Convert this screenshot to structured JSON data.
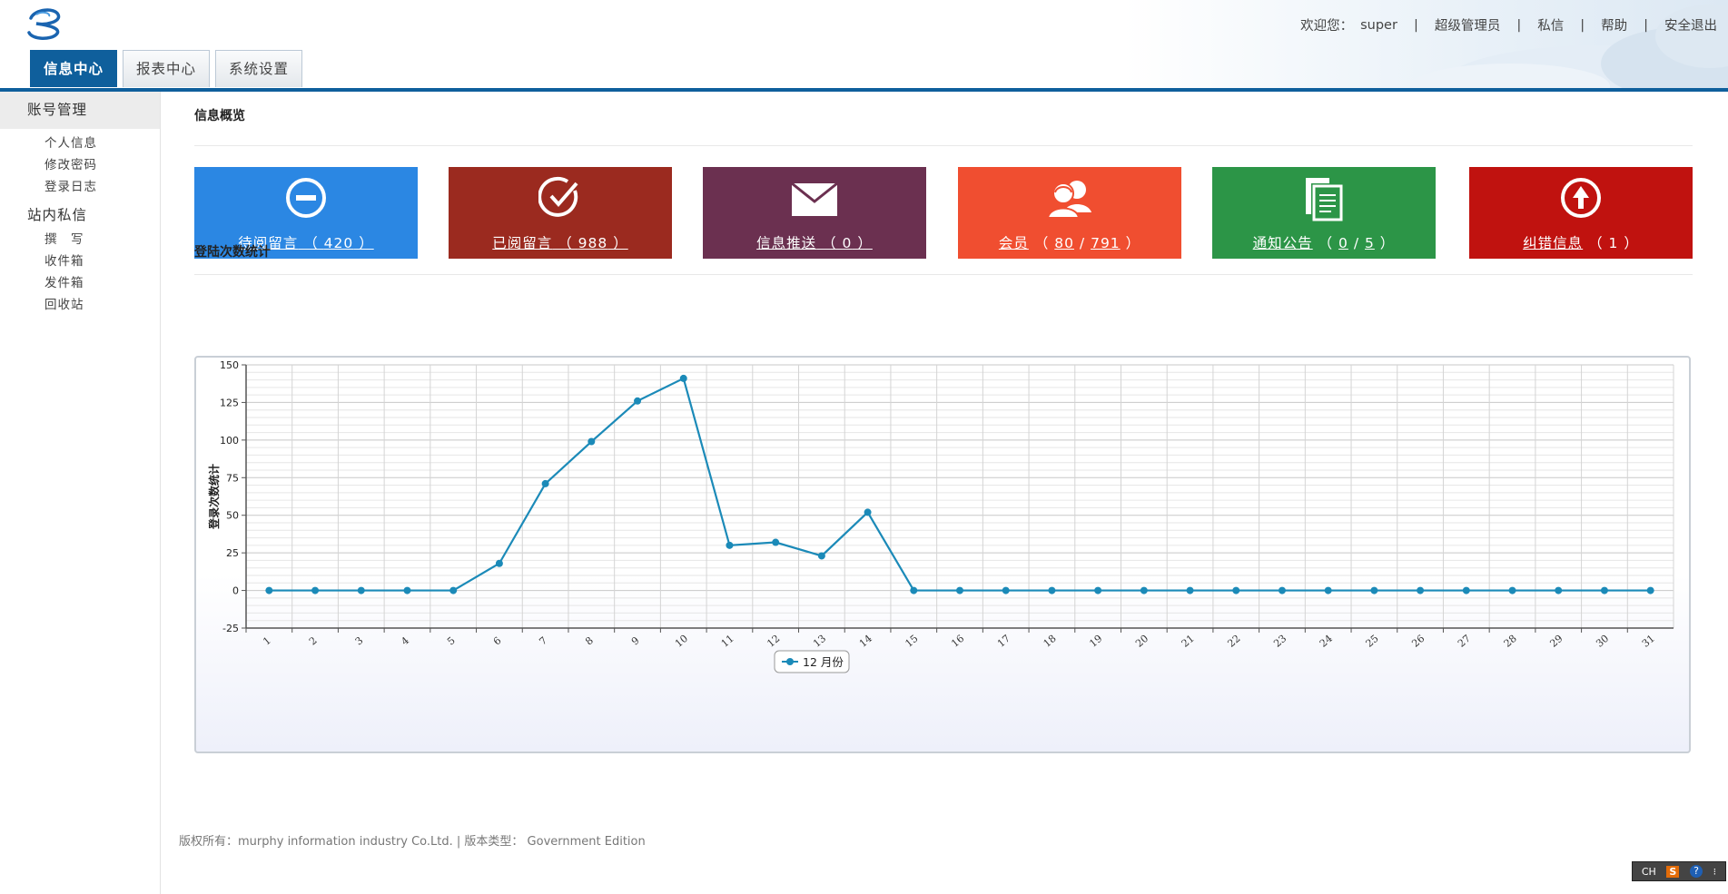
{
  "header": {
    "welcome": "欢迎您：",
    "user": "super",
    "role": "超级管理员",
    "messages": "私信",
    "help": "帮助",
    "logout": "安全退出",
    "tabs": [
      "信息中心",
      "报表中心",
      "系统设置"
    ]
  },
  "sidebar": {
    "group1": "账号管理",
    "items1": [
      "个人信息",
      "修改密码",
      "登录日志"
    ],
    "group2": "站内私信",
    "items2": [
      "撰　写",
      "收件箱",
      "发件箱",
      "回收站"
    ]
  },
  "overview": {
    "title": "信息概览",
    "cards": [
      {
        "label": "待阅留言",
        "count": "420",
        "color": "#2b87e3",
        "icon": "minus-circle-icon"
      },
      {
        "label": "已阅留言",
        "count": "988",
        "color": "#9b2a1f",
        "icon": "check-circle-icon"
      },
      {
        "label": "信息推送",
        "count": "0",
        "color": "#6b3050",
        "icon": "envelope-icon"
      },
      {
        "label": "会员",
        "count_a": "80",
        "count_b": "791",
        "color": "#f04e30",
        "icon": "users-icon"
      },
      {
        "label": "通知公告",
        "count_a": "0",
        "count_b": "5",
        "color": "#2c9547",
        "icon": "documents-icon"
      },
      {
        "label": "纠错信息",
        "count": "1",
        "color": "#c0120f",
        "icon": "up-arrow-circle-icon"
      }
    ]
  },
  "login_stats": {
    "title": "登陆次数统计"
  },
  "chart_data": {
    "type": "line",
    "title": "",
    "ylabel": "登录次数统计",
    "xlabel": "",
    "x": [
      1,
      2,
      3,
      4,
      5,
      6,
      7,
      8,
      9,
      10,
      11,
      12,
      13,
      14,
      15,
      16,
      17,
      18,
      19,
      20,
      21,
      22,
      23,
      24,
      25,
      26,
      27,
      28,
      29,
      30,
      31
    ],
    "ylim": [
      -25,
      150
    ],
    "yticks": [
      -25,
      0,
      25,
      50,
      75,
      100,
      125,
      150
    ],
    "grid": true,
    "legend": "bottom-center",
    "series": [
      {
        "name": "12 月份",
        "color": "#1b8ab8",
        "values": [
          0,
          0,
          0,
          0,
          0,
          18,
          71,
          99,
          126,
          141,
          30,
          32,
          23,
          52,
          0,
          0,
          0,
          0,
          0,
          0,
          0,
          0,
          0,
          0,
          0,
          0,
          0,
          0,
          0,
          0,
          0
        ]
      }
    ]
  },
  "footer": {
    "text": "版权所有：murphy information industry Co.Ltd. | 版本类型： Government Edition"
  },
  "ime": {
    "label": "CH",
    "s": "S",
    "help": "?"
  }
}
